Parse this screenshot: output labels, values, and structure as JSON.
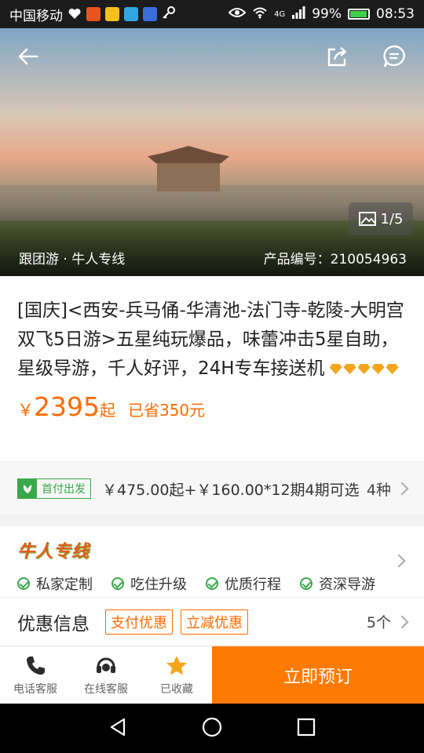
{
  "status_bar": {
    "carrier": "中国移动",
    "signal_label": "4G",
    "battery": "99%",
    "time": "08:53"
  },
  "hero": {
    "image_counter": "1/5",
    "tour_type": "跟团游 · 牛人专线",
    "product_code": "产品编号：210054963"
  },
  "product": {
    "title": "[国庆]<西安-兵马俑-华清池-法门寺-乾陵-大明宫双飞5日游>五星纯玩爆品，味蕾冲击5星自助，星级导游，千人好评，24H专车接送机",
    "rating_diamonds": 5,
    "price_symbol": "￥",
    "price": "2395",
    "price_suffix": "起",
    "saved": "已省350元"
  },
  "installment": {
    "badge": "首付出发",
    "text": "￥475.00起+￥160.00*12期4期可选",
    "count": "4种"
  },
  "features": {
    "brand": "牛人专线",
    "items": [
      "私家定制",
      "吃住升级",
      "优质行程",
      "资深导游"
    ]
  },
  "promo": {
    "title": "优惠信息",
    "tags": [
      "支付优惠",
      "立减优惠"
    ],
    "count": "5个"
  },
  "bottom_bar": {
    "phone": "电话客服",
    "online": "在线客服",
    "favorited": "已收藏",
    "book": "立即预订"
  },
  "colors": {
    "accent": "#ff7a00",
    "price": "#ff6a00",
    "green": "#3aa84a",
    "star": "#f3a51d"
  }
}
